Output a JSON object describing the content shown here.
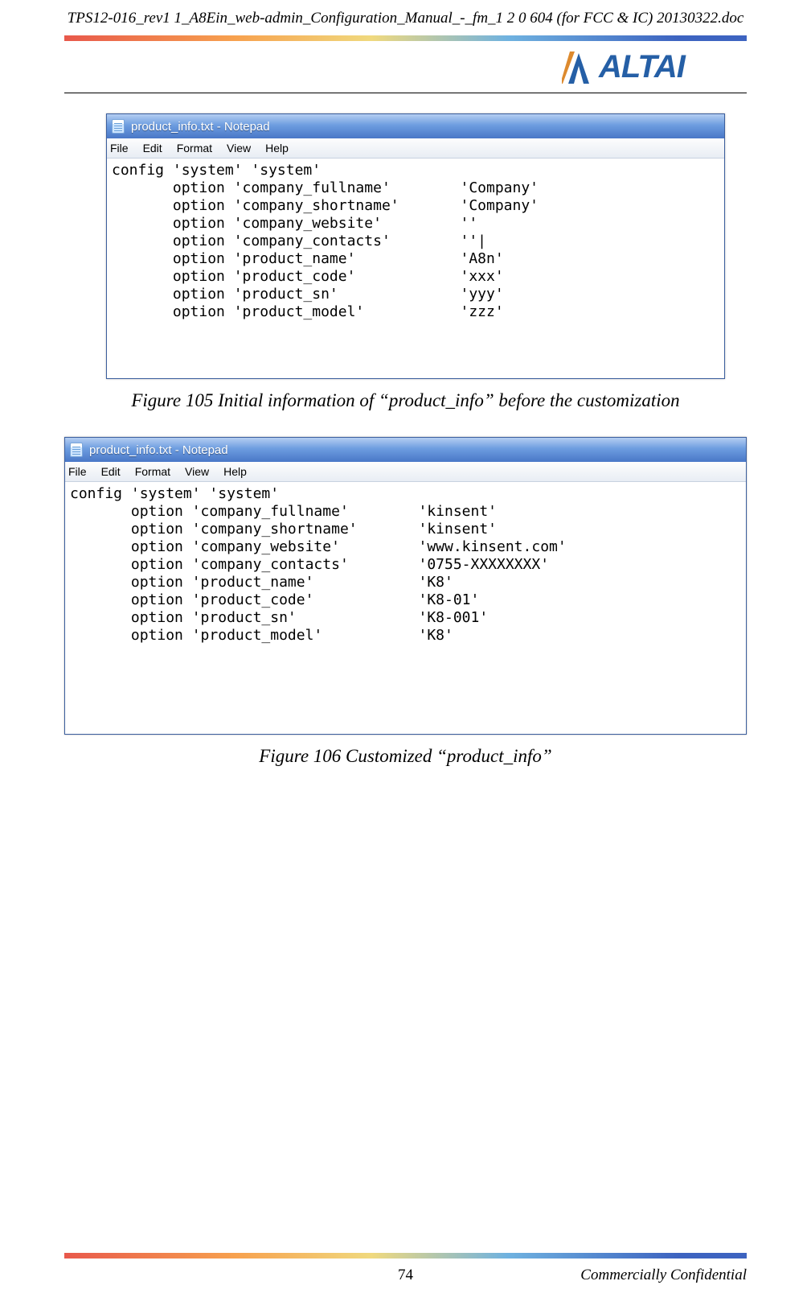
{
  "header": {
    "filename": "TPS12-016_rev1 1_A8Ein_web-admin_Configuration_Manual_-_fm_1 2 0 604 (for FCC & IC) 20130322.doc",
    "brand": "ALTAI"
  },
  "notepad1": {
    "title": "product_info.txt - Notepad",
    "menu": {
      "file": "File",
      "edit": "Edit",
      "format": "Format",
      "view": "View",
      "help": "Help"
    },
    "body": "config 'system' 'system'\n       option 'company_fullname'        'Company'\n       option 'company_shortname'       'Company'\n       option 'company_website'         ''\n       option 'company_contacts'        ''|\n       option 'product_name'            'A8n'\n       option 'product_code'            'xxx'\n       option 'product_sn'              'yyy'\n       option 'product_model'           'zzz'"
  },
  "caption1": "Figure 105 Initial information of  “product_info”  before the customization",
  "notepad2": {
    "title": "product_info.txt - Notepad",
    "menu": {
      "file": "File",
      "edit": "Edit",
      "format": "Format",
      "view": "View",
      "help": "Help"
    },
    "body": "config 'system' 'system'\n       option 'company_fullname'        'kinsent'\n       option 'company_shortname'       'kinsent'\n       option 'company_website'         'www.kinsent.com'\n       option 'company_contacts'        '0755-XXXXXXXX'\n       option 'product_name'            'K8'\n       option 'product_code'            'K8-01'\n       option 'product_sn'              'K8-001'\n       option 'product_model'           'K8'"
  },
  "caption2": "Figure 106 Customized “product_info”",
  "footer": {
    "page": "74",
    "confidential": "Commercially Confidential"
  }
}
